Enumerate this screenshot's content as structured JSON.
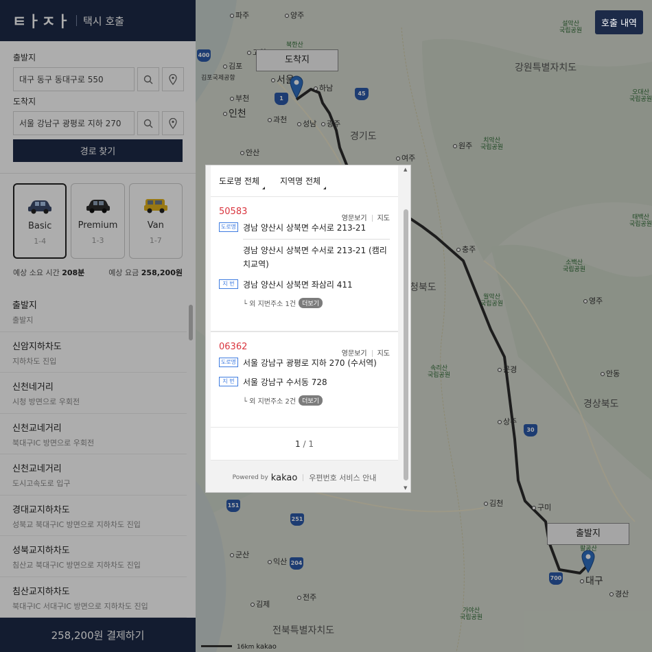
{
  "app": {
    "logo": "ㅌㅏㅈㅏ",
    "subtitle": "택시 호출"
  },
  "map": {
    "history_button": "호출 내역",
    "arrival_marker": "도착지",
    "departure_marker": "출발지",
    "scale_label": "16km",
    "scale_brand": "kakao",
    "places": {
      "paju": "파주",
      "yangju": "양주",
      "bukhansan": "북한산",
      "goyang": "고양",
      "gimpo": "김포",
      "gimpo_airport": "김포국제공항",
      "seoul": "서울",
      "hanam": "하남",
      "bucheon": "부천",
      "incheon": "인천",
      "gwacheon": "과천",
      "seongnam": "성남",
      "gwangju": "광주",
      "ansan": "안산",
      "gyeonggi": "경기도",
      "gangwon": "강원특별자치도",
      "wonju": "원주",
      "yeoju": "여주",
      "chungju": "충주",
      "chungbuk": "청북도",
      "yeongju": "영주",
      "mungyeong": "문경",
      "sangju": "상주",
      "andong": "안동",
      "gyeongbuk": "경상북도",
      "gimcheon": "김천",
      "gumi": "구미",
      "daegu": "대구",
      "gyeongsan": "경산",
      "gunsan": "군산",
      "iksan": "익산",
      "jeonju": "전주",
      "gimje": "김제",
      "jeonbuk": "전북특별자치도",
      "park_seorak": "설악산\n국립공원",
      "park_chiak": "치악산\n국립공원",
      "park_woraksan": "월악산\n국립공원",
      "park_sobaek": "소백산\n국립공원",
      "park_songni": "속리산\n국립공원",
      "park_taebaek": "태백산\n국립공원",
      "park_gaya": "가야산\n국립공원",
      "park_palgong": "팔공산",
      "park_odae": "오대산\n국립공원"
    },
    "highways": [
      "400",
      "1",
      "45",
      "151",
      "251",
      "204",
      "700",
      "30"
    ]
  },
  "form": {
    "departure_label": "출발지",
    "departure_value": "대구 동구 동대구로 550",
    "destination_label": "도착지",
    "destination_value": "서울 강남구 광평로 지하 270",
    "route_button": "경로 찾기"
  },
  "cars": [
    {
      "name": "Basic",
      "capacity": "1-4",
      "active": true,
      "color": "#3b4a6b"
    },
    {
      "name": "Premium",
      "capacity": "1-3",
      "active": false,
      "color": "#2d2d2d"
    },
    {
      "name": "Van",
      "capacity": "1-7",
      "active": false,
      "color": "#e0b21c"
    }
  ],
  "estimate": {
    "time_label": "예상 소요 시간",
    "time_value": "208분",
    "fare_label": "예상 요금",
    "fare_value": "258,200원"
  },
  "stops": [
    {
      "title": "출발지",
      "sub": "출발지"
    },
    {
      "title": "신암지하차도",
      "sub": "지하차도 진입"
    },
    {
      "title": "신천네거리",
      "sub": "시청 방면으로 우회전"
    },
    {
      "title": "신천교네거리",
      "sub": "북대구IC 방면으로 우회전"
    },
    {
      "title": "신천교네거리",
      "sub": "도시고속도로 입구"
    },
    {
      "title": "경대교지하차도",
      "sub": "성북교 북대구IC 방면으로 지하차도 진입"
    },
    {
      "title": "성북교지하차도",
      "sub": "침산교 북대구IC 방면으로 지하차도 진입"
    },
    {
      "title": "침산교지하차도",
      "sub": "북대구IC 서대구IC 방면으로 지하차도 진입"
    }
  ],
  "pay_button": "258,200원 결제하기",
  "postcode": {
    "filter_road": "도로명 전체",
    "filter_region": "지역명 전체",
    "tag_road": "도로명",
    "tag_jibun": "지 번",
    "link_english": "영문보기",
    "link_map": "지도",
    "results": [
      {
        "zip": "50583",
        "road": "경남 양산시 상북면 수서로 213-21",
        "road_alt": "경남 양산시 상북면 수서로 213-21 (캠리치교역)",
        "jibun": "경남 양산시 상북면 좌삼리 411",
        "extra": "└ 외 지번주소 1건",
        "more": "더보기"
      },
      {
        "zip": "06362",
        "road": "서울 강남구 광평로 지하 270 (수서역)",
        "jibun": "서울 강남구 수서동 728",
        "extra": "└ 외 지번주소 2건",
        "more": "더보기"
      }
    ],
    "pager_current": "1",
    "pager_sep": "/",
    "pager_total": "1",
    "powered_by": "Powered by",
    "kakao": "kakao",
    "guide": "우편번호 서비스 안내"
  }
}
